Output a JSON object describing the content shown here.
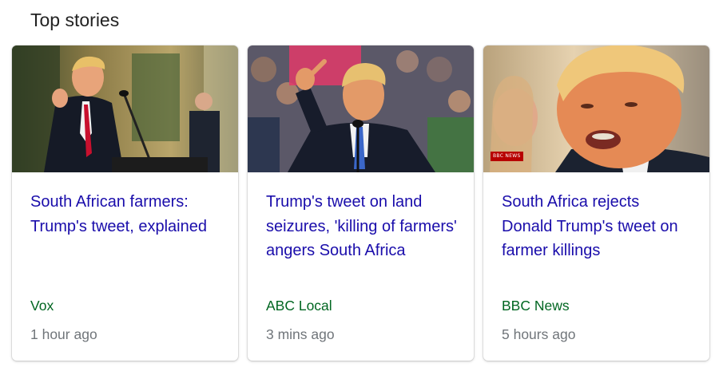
{
  "section": {
    "title": "Top stories"
  },
  "stories": [
    {
      "headline": "South African farmers: Trump's tweet, explained",
      "source": "Vox",
      "time": "1 hour ago",
      "image": "trump-podium-photo"
    },
    {
      "headline": "Trump's tweet on land seizures, 'killing of farmers' angers South Africa",
      "source": "ABC Local",
      "time": "3 mins ago",
      "image": "trump-pointing-rally-photo"
    },
    {
      "headline": "South Africa rejects Donald Trump's tweet on farmer killings",
      "source": "BBC News",
      "time": "5 hours ago",
      "image": "trump-closeup-photo",
      "image_badge": "BBC NEWS"
    }
  ],
  "colors": {
    "headline": "#1a0dab",
    "source": "#006621",
    "time": "#70757a",
    "title": "#222222"
  }
}
